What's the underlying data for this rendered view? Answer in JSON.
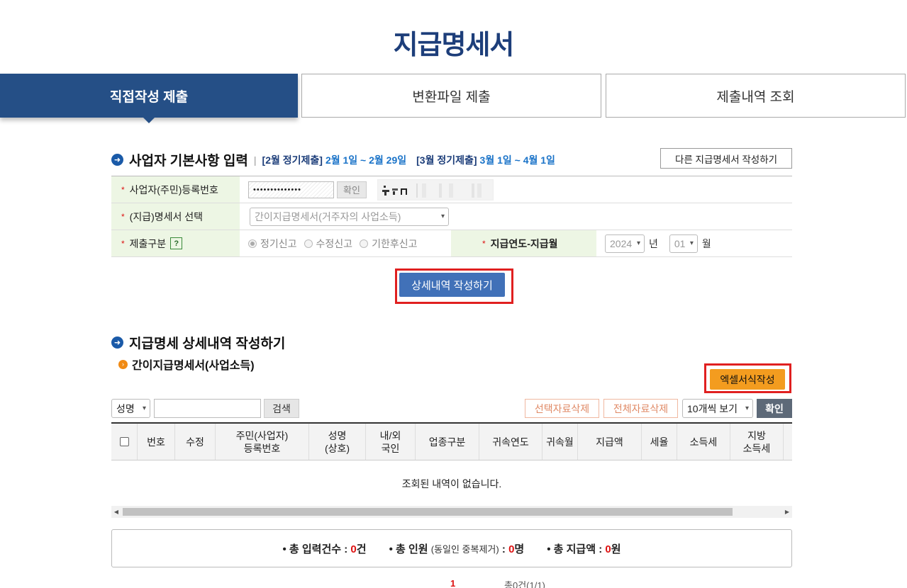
{
  "page": {
    "title": "지급명세서"
  },
  "tabs": [
    {
      "label": "직접작성 제출",
      "active": true
    },
    {
      "label": "변환파일 제출",
      "active": false
    },
    {
      "label": "제출내역 조회",
      "active": false
    }
  ],
  "basic_section": {
    "title": "사업자 기본사항 입력",
    "period1_label": "[2월 정기제출]",
    "period1_range": "2월 1일 ~ 2월 29일",
    "period2_label": "[3월 정기제출]",
    "period2_range": "3월 1일 ~ 4월 1일",
    "other_statement_button": "다른 지급명세서 작성하기"
  },
  "form": {
    "reg_no": {
      "label": "사업자(주민)등록번호",
      "masked_value": "••••••••••••••",
      "confirm_button": "확인"
    },
    "statement_select": {
      "label": "(지급)명세서 선택",
      "value": "간이지급명세서(거주자의 사업소득)"
    },
    "submit_type": {
      "label": "제출구분",
      "help": "?",
      "options": [
        "정기신고",
        "수정신고",
        "기한후신고"
      ],
      "selected": "정기신고"
    },
    "pay_period": {
      "label": "지급연도-지급월",
      "year": "2024",
      "year_unit": "년",
      "month": "01",
      "month_unit": "월"
    }
  },
  "detail_button": "상세내역 작성하기",
  "detail_section": {
    "title": "지급명세 상세내역 작성하기",
    "subtitle": "간이지급명세서(사업소득)",
    "excel_button": "엑셀서식작성"
  },
  "controls": {
    "search_field": "성명",
    "search_value": "",
    "search_button": "검색",
    "delete_selected": "선택자료삭제",
    "delete_all": "전체자료삭제",
    "page_size": "10개씩 보기",
    "confirm_button": "확인"
  },
  "table": {
    "columns": [
      "번호",
      "수정",
      "주민(사업자)\n등록번호",
      "성명\n(상호)",
      "내/외\n국인",
      "업종구분",
      "귀속연도",
      "귀속월",
      "지급액",
      "세율",
      "소득세",
      "지방\n소득세"
    ],
    "empty_message": "조회된 내역이 없습니다."
  },
  "summary": {
    "total_entries_label": "총 입력건수 :",
    "total_entries_value": "0",
    "total_entries_unit": "건",
    "total_people_label": "총 인원",
    "total_people_note": "(동일인 중복제거)",
    "total_people_colon": ":",
    "total_people_value": "0",
    "total_people_unit": "명",
    "total_pay_label": "총 지급액 :",
    "total_pay_value": "0",
    "total_pay_unit": "원"
  },
  "pagination": {
    "current_page": "1",
    "total_text": "총0건(1/1)"
  },
  "colors": {
    "title": "#1d3e7a",
    "active_tab": "#254f86",
    "primary_button": "#4171b8",
    "excel_button": "#f39c1f",
    "highlight_frame": "#e02020",
    "label_bg": "#edf6e4"
  }
}
